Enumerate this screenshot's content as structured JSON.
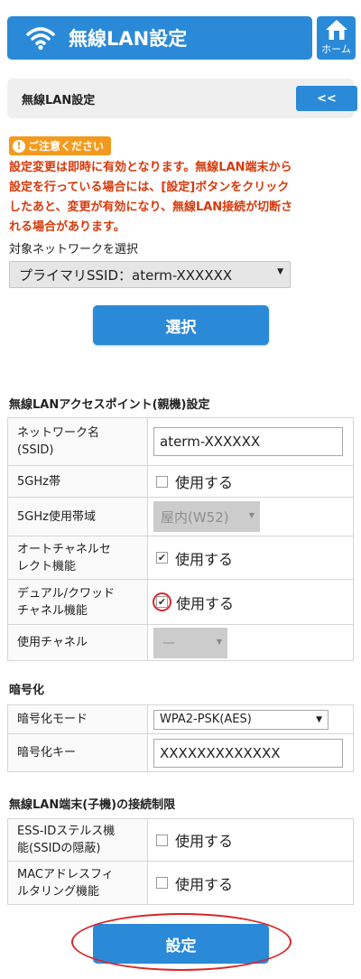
{
  "header": {
    "title": "無線LAN設定",
    "home_label": "ホーム"
  },
  "subbar": {
    "title": "無線LAN設定",
    "back_label": "<<"
  },
  "caution": {
    "badge": "ご注意ください",
    "lines": [
      "設定変更は即時に有効となります。無線LAN端末から",
      "設定を行っている場合には、[設定]ボタンをクリック",
      "したあと、変更が有効になり、無線LAN接続が切断さ",
      "れる場合があります。"
    ]
  },
  "network_select": {
    "label": "対象ネットワークを選択",
    "value": "プライマリSSID：aterm-XXXXXX"
  },
  "select_button": "選択",
  "ap_section": {
    "title": "無線LANアクセスポイント(親機)設定",
    "ssid_label_1": "ネットワーク名",
    "ssid_label_2": "(SSID)",
    "ssid_value": "aterm-XXXXXX",
    "band5_label": "5GHz帯",
    "band5_check": "使用する",
    "band5_range_label": "5GHz使用帯域",
    "band5_range_value": "屋内(W52)",
    "auto_channel_label_1": "オートチャネルセ",
    "auto_channel_label_2": "レクト機能",
    "auto_channel_check": "使用する",
    "dual_quad_label_1": "デュアル/クワッド",
    "dual_quad_label_2": "チャネル機能",
    "dual_quad_check": "使用する",
    "channel_label": "使用チャネル",
    "channel_value": "—"
  },
  "enc_section": {
    "title": "暗号化",
    "mode_label": "暗号化モード",
    "mode_value": "WPA2-PSK(AES)",
    "key_label": "暗号化キー",
    "key_value": "XXXXXXXXXXXXX"
  },
  "client_section": {
    "title": "無線LAN端末(子機)の接続制限",
    "stealth_label_1": "ESS-IDステルス機",
    "stealth_label_2": "能(SSIDの隠蔽)",
    "stealth_check": "使用する",
    "mac_label_1": "MACアドレスフィ",
    "mac_label_2": "ルタリング機能",
    "mac_check": "使用する"
  },
  "set_button": "設定",
  "colors": {
    "primary": "#2a8ad8",
    "warning": "#d63a0c",
    "caution_badge": "#f39a1e",
    "highlight": "#d8262a"
  }
}
